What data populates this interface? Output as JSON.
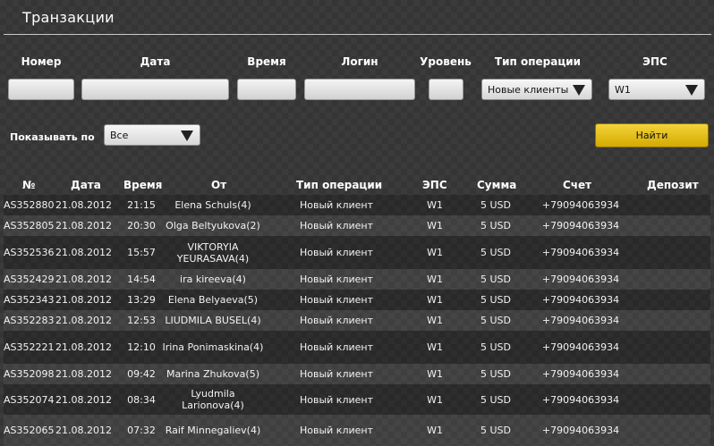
{
  "page": {
    "title": "Транзакции"
  },
  "filters": {
    "labels": {
      "number": "Номер",
      "date": "Дата",
      "time": "Время",
      "login": "Логин",
      "level": "Уровень",
      "op_type": "Тип операции",
      "eps": "ЭПС"
    },
    "op_type_value": "Новые клиенты",
    "eps_value": "W1",
    "show_by_label": "Показывать по",
    "show_by_value": "Все",
    "find_label": "Найти"
  },
  "table": {
    "headers": {
      "num": "№",
      "date": "Дата",
      "time": "Время",
      "from": "От",
      "type": "Тип операции",
      "eps": "ЭПС",
      "sum": "Сумма",
      "account": "Счет",
      "deposit": "Депозит"
    },
    "rows": [
      {
        "num": "AS352880",
        "date": "21.08.2012",
        "time": "21:15",
        "from": "Elena Schuls(4)",
        "type": "Новый клиент",
        "eps": "W1",
        "sum": "5 USD",
        "account": "+79094063934",
        "deposit": ""
      },
      {
        "num": "AS352805",
        "date": "21.08.2012",
        "time": "20:30",
        "from": "Olga Beltyukova(2)",
        "type": "Новый клиент",
        "eps": "W1",
        "sum": "5 USD",
        "account": "+79094063934",
        "deposit": ""
      },
      {
        "num": "AS352536",
        "date": "21.08.2012",
        "time": "15:57",
        "from": "VIKTORYIA YEURASAVA(4)",
        "type": "Новый клиент",
        "eps": "W1",
        "sum": "5 USD",
        "account": "+79094063934",
        "deposit": ""
      },
      {
        "num": "AS352429",
        "date": "21.08.2012",
        "time": "14:54",
        "from": "ira kireeva(4)",
        "type": "Новый клиент",
        "eps": "W1",
        "sum": "5 USD",
        "account": "+79094063934",
        "deposit": ""
      },
      {
        "num": "AS352343",
        "date": "21.08.2012",
        "time": "13:29",
        "from": "Elena Belyaeva(5)",
        "type": "Новый клиент",
        "eps": "W1",
        "sum": "5 USD",
        "account": "+79094063934",
        "deposit": ""
      },
      {
        "num": "AS352283",
        "date": "21.08.2012",
        "time": "12:53",
        "from": "LIUDMILA BUSEL(4)",
        "type": "Новый клиент",
        "eps": "W1",
        "sum": "5 USD",
        "account": "+79094063934",
        "deposit": ""
      },
      {
        "num": "AS352221",
        "date": "21.08.2012",
        "time": "12:10",
        "from": "Irina Ponimaskina(4)",
        "type": "Новый клиент",
        "eps": "W1",
        "sum": "5 USD",
        "account": "+79094063934",
        "deposit": ""
      },
      {
        "num": "AS352098",
        "date": "21.08.2012",
        "time": "09:42",
        "from": "Marina Zhukova(5)",
        "type": "Новый клиент",
        "eps": "W1",
        "sum": "5 USD",
        "account": "+79094063934",
        "deposit": ""
      },
      {
        "num": "AS352074",
        "date": "21.08.2012",
        "time": "08:34",
        "from": "Lyudmila Larionova(4)",
        "type": "Новый клиент",
        "eps": "W1",
        "sum": "5 USD",
        "account": "+79094063934",
        "deposit": ""
      },
      {
        "num": "AS352065",
        "date": "21.08.2012",
        "time": "07:32",
        "from": "Raif Minnegaliev(4)",
        "type": "Новый клиент",
        "eps": "W1",
        "sum": "5 USD",
        "account": "+79094063934",
        "deposit": ""
      }
    ]
  },
  "colors": {
    "accent": "#e6c31a",
    "row_dark": "#2c2c2c",
    "row_light": "#4a4a4a"
  }
}
